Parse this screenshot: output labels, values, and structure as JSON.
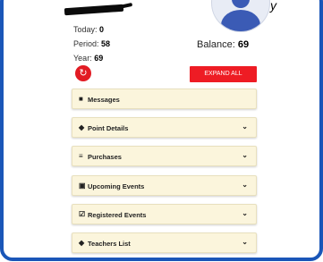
{
  "profile": {
    "stats": [
      {
        "label": "Today:",
        "value": "0"
      },
      {
        "label": "Period:",
        "value": "58"
      },
      {
        "label": "Year:",
        "value": "69"
      }
    ],
    "balance_label": "Balance:",
    "balance_value": "69"
  },
  "actions": {
    "expand_all_label": "EXPAND ALL",
    "refresh_icon": "refresh-icon"
  },
  "panels": [
    {
      "label": "Messages",
      "icon": "message-icon",
      "expandable": false
    },
    {
      "label": "Point Details",
      "icon": "graduation-cap-icon",
      "expandable": true
    },
    {
      "label": "Purchases",
      "icon": "cart-icon",
      "expandable": true
    },
    {
      "label": "Upcoming Events",
      "icon": "calendar-icon",
      "expandable": true
    },
    {
      "label": "Registered Events",
      "icon": "calendar-check-icon",
      "expandable": true
    },
    {
      "label": "Teachers List",
      "icon": "graduation-cap-icon",
      "expandable": true
    }
  ],
  "colors": {
    "frame_border": "#1a56b8",
    "accent_red": "#ee1c24",
    "panel_bg": "#fbf5dc",
    "avatar_blue": "#3b5bb5"
  }
}
